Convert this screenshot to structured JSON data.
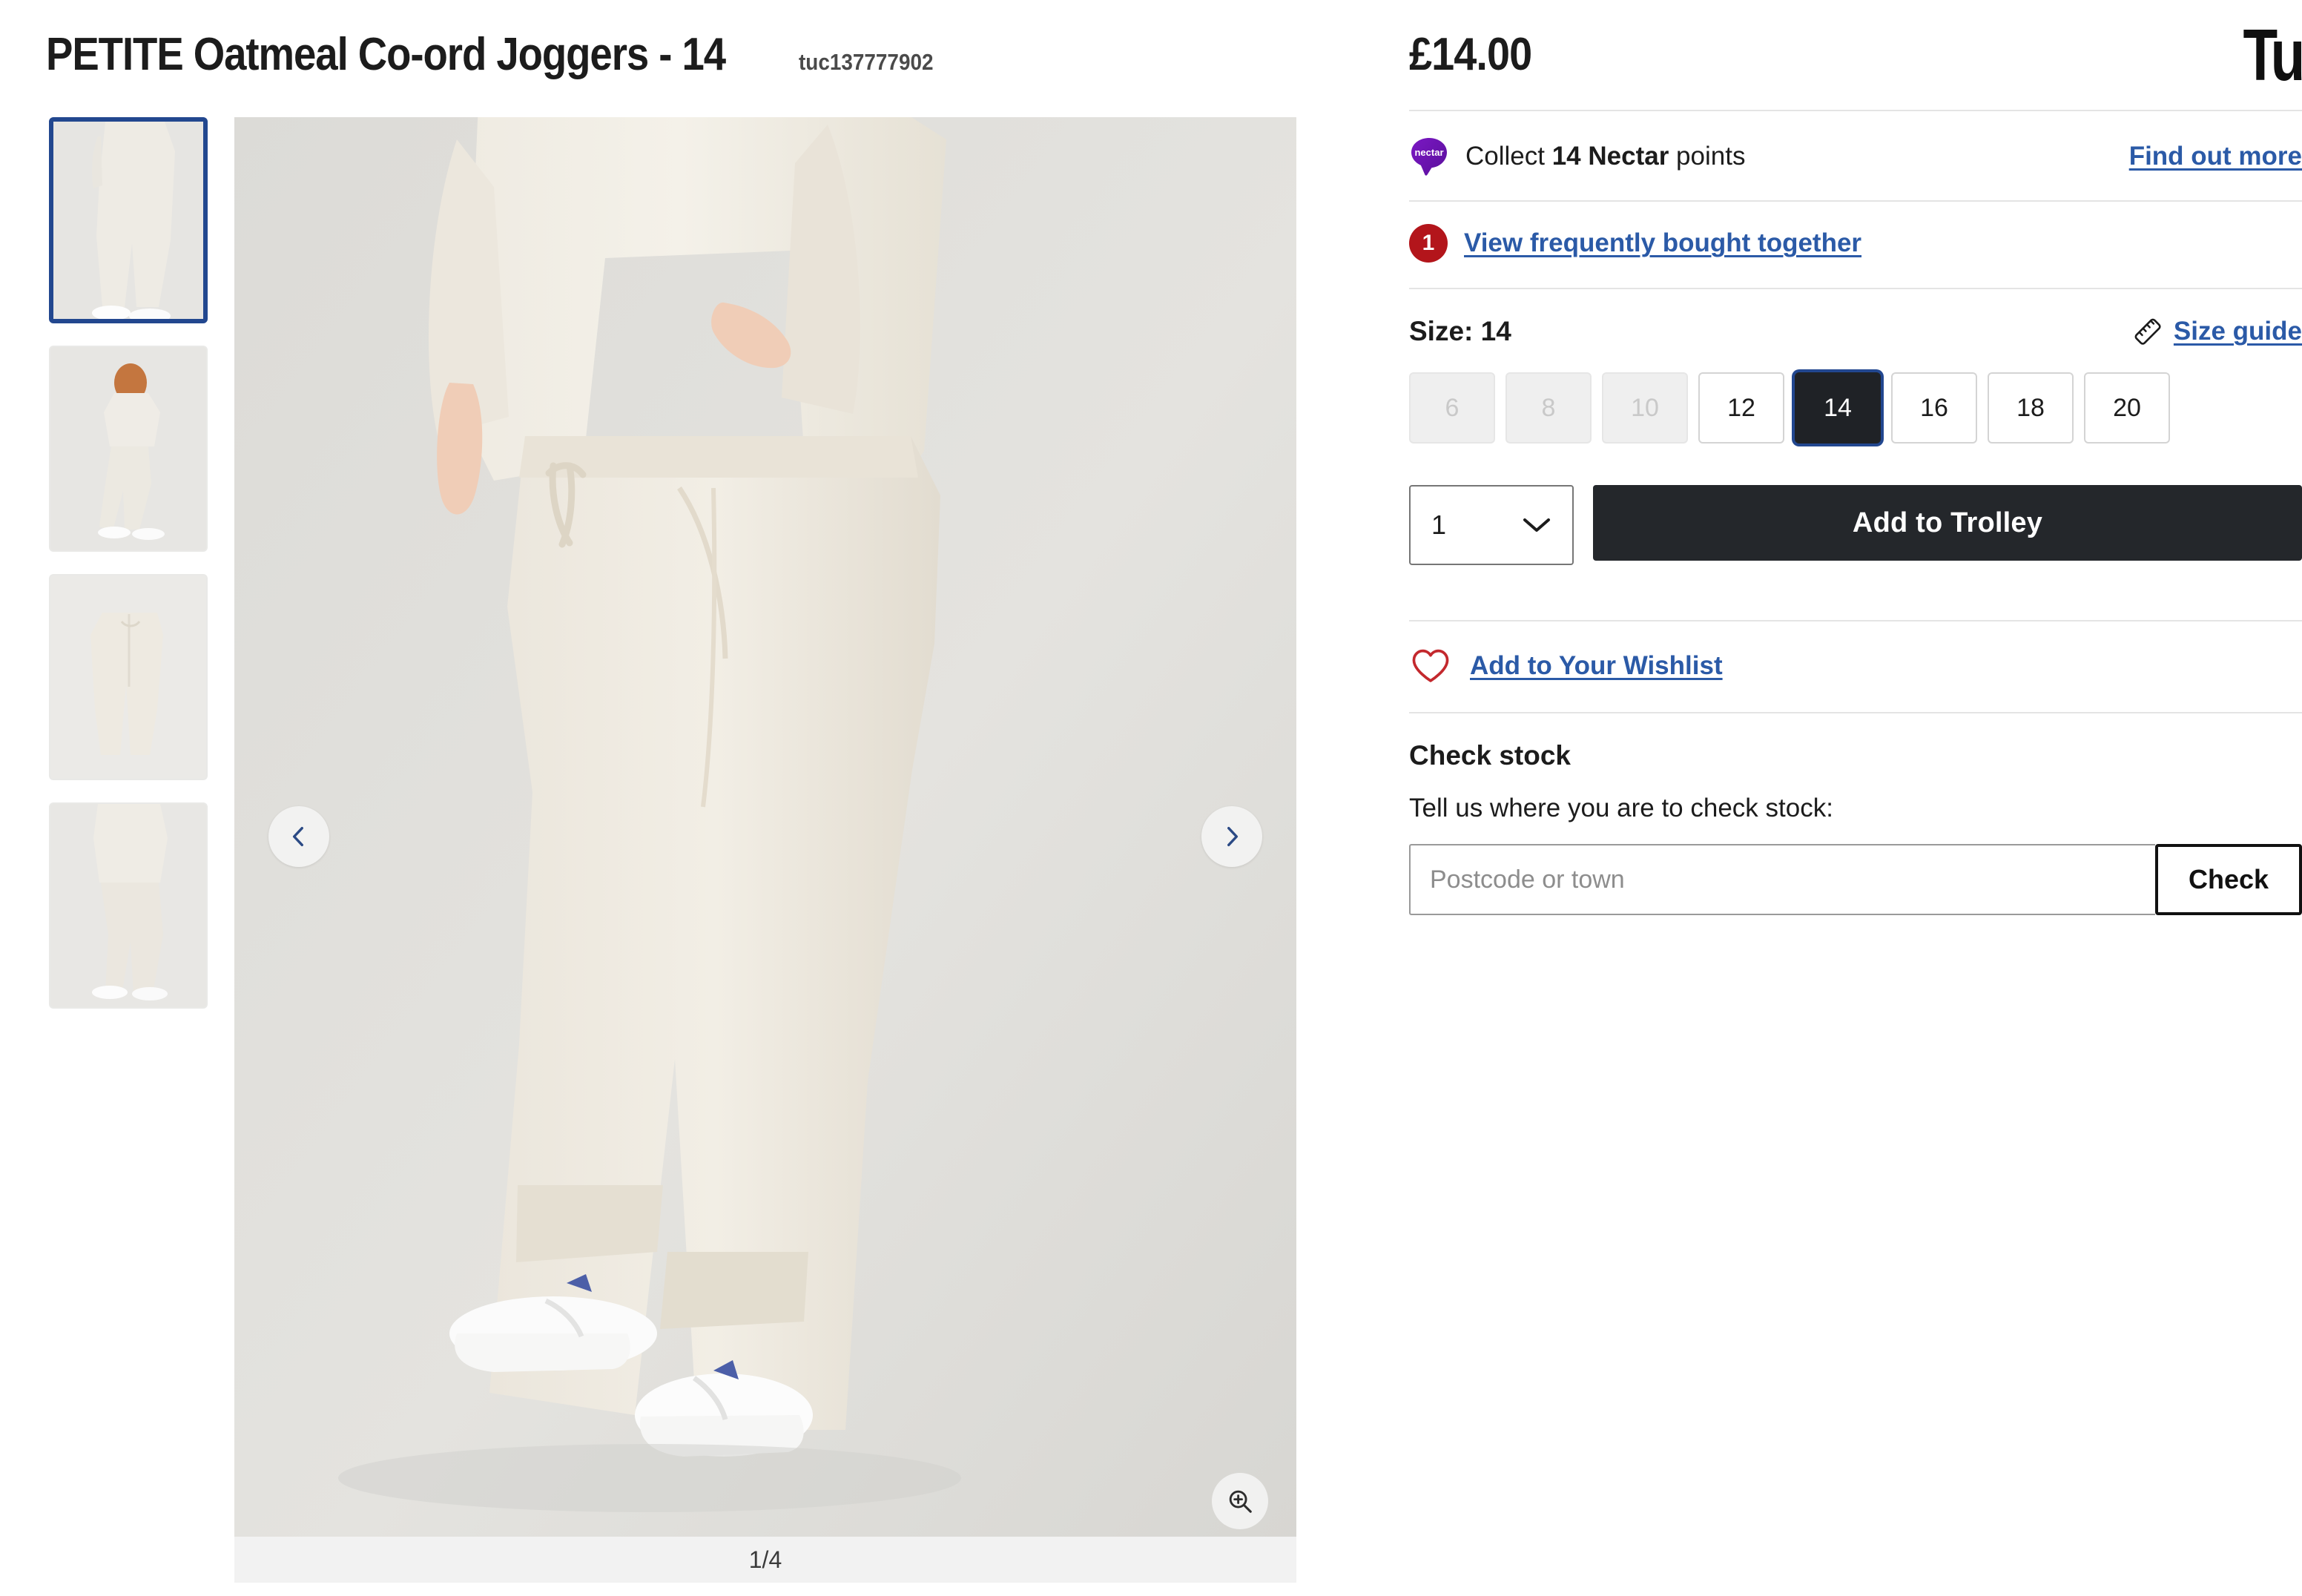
{
  "product": {
    "title": "PETITE Oatmeal Co-ord Joggers - 14",
    "sku": "tuc137777902",
    "price": "£14.00",
    "brand_logo": "Tu"
  },
  "gallery": {
    "counter": "1/4",
    "total_images": 4,
    "current_index": 1,
    "prev_label": "Previous image",
    "next_label": "Next image",
    "zoom_label": "Zoom image",
    "thumbnails": [
      {
        "alt": "Model wearing oatmeal joggers, cropped lower body",
        "selected": true
      },
      {
        "alt": "Model wearing oatmeal co-ord full length",
        "selected": false
      },
      {
        "alt": "Flat lay of oatmeal joggers",
        "selected": false
      },
      {
        "alt": "Model side view of oatmeal joggers",
        "selected": false
      }
    ]
  },
  "nectar": {
    "badge_text": "nectar",
    "prefix": "Collect ",
    "points": "14 Nectar",
    "suffix": " points",
    "find_out_more": "Find out more"
  },
  "frequently_bought": {
    "badge_count": "1",
    "link_label": "View frequently bought together"
  },
  "size": {
    "label": "Size: 14",
    "guide_label": "Size guide",
    "selected": "14",
    "options": [
      {
        "value": "6",
        "state": "disabled"
      },
      {
        "value": "8",
        "state": "disabled"
      },
      {
        "value": "10",
        "state": "disabled"
      },
      {
        "value": "12",
        "state": "available"
      },
      {
        "value": "14",
        "state": "selected"
      },
      {
        "value": "16",
        "state": "available"
      },
      {
        "value": "18",
        "state": "available"
      },
      {
        "value": "20",
        "state": "available"
      }
    ]
  },
  "purchase": {
    "quantity": "1",
    "add_to_trolley": "Add to Trolley"
  },
  "wishlist": {
    "label": "Add to Your Wishlist"
  },
  "check_stock": {
    "heading": "Check stock",
    "subtitle": "Tell us where you are to check stock:",
    "placeholder": "Postcode or town",
    "input_value": "",
    "button_label": "Check"
  },
  "colors": {
    "link_blue": "#2b5aa7",
    "selected_ring": "#22478f",
    "badge_red": "#b3151b",
    "nectar_purple": "#7317b8",
    "dark_button": "#24272b",
    "heart_red": "#c3282d"
  }
}
